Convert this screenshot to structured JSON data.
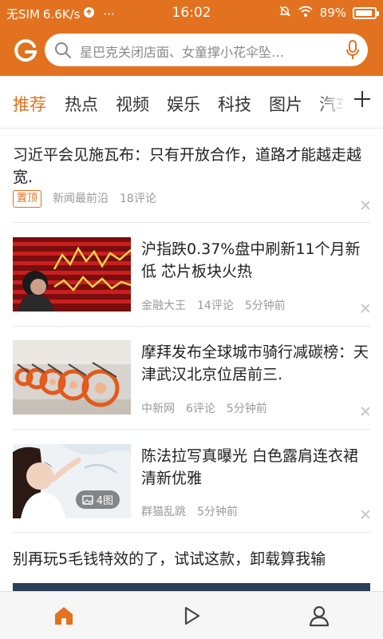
{
  "status_bar": {
    "carrier": "无SIM",
    "speed": "6.6K/s",
    "more": "···",
    "time": "16:02",
    "battery": "89%",
    "battery_level": 0.89
  },
  "search": {
    "placeholder": "星巴克关闭店面、女童撑小花伞坠…"
  },
  "tabs": [
    "推荐",
    "热点",
    "视频",
    "娱乐",
    "科技",
    "图片",
    "汽车"
  ],
  "active_tab": 0,
  "feed": [
    {
      "title": "习近平会见施瓦布：只有开放合作，道路才能越走越宽.",
      "badge": "置顶",
      "source": "新闻最前沿",
      "comments": "18评论"
    },
    {
      "title": "沪指跌0.37%盘中刷新11个月新低 芯片板块火热",
      "source": "金融大王",
      "comments": "14评论",
      "time": "5分钟前"
    },
    {
      "title": "摩拜发布全球城市骑行减碳榜：天津武汉北京位居前三.",
      "source": "中新网",
      "comments": "6评论",
      "time": "5分钟前"
    },
    {
      "title": "陈法拉写真曝光 白色露肩连衣裙清新优雅",
      "image_count": "4图",
      "source": "群猫乱跳",
      "time": "5分钟前"
    },
    {
      "title": "别再玩5毛钱特效的了，试试这款，卸载算我输"
    }
  ],
  "colors": {
    "brand": "#e2721f",
    "text": "#222222",
    "meta": "#9a9a9a"
  },
  "icons": {
    "logo": "brand-g-logo",
    "search": "search-icon",
    "mic": "mic-icon",
    "add_tab": "plus-icon",
    "home": "home-icon",
    "video": "play-icon",
    "profile": "user-icon"
  }
}
